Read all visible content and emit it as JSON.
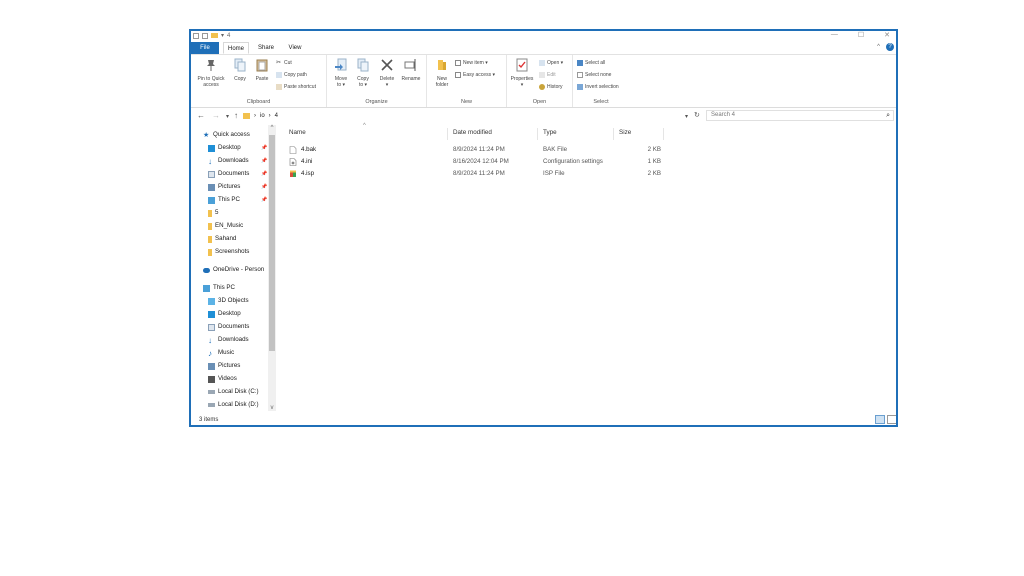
{
  "titlebar": {
    "title": "4"
  },
  "tabs": {
    "file": "File",
    "home": "Home",
    "share": "Share",
    "view": "View"
  },
  "ribbon": {
    "clipboard": {
      "label": "Clipboard",
      "pin_line1": "Pin to Quick",
      "pin_line2": "access",
      "copy": "Copy",
      "paste": "Paste",
      "cut": "Cut",
      "copy_path": "Copy path",
      "paste_shortcut": "Paste shortcut"
    },
    "organize": {
      "label": "Organize",
      "move_line1": "Move",
      "move_line2": "to ▾",
      "copy_line1": "Copy",
      "copy_line2": "to ▾",
      "delete_line1": "Delete",
      "delete_line2": "▾",
      "rename": "Rename"
    },
    "new": {
      "label": "New",
      "folder_line1": "New",
      "folder_line2": "folder",
      "new_item": "New item ▾",
      "easy_access": "Easy access ▾"
    },
    "open": {
      "label": "Open",
      "properties_line1": "Properties",
      "properties_line2": "▾",
      "open": "Open ▾",
      "edit": "Edit",
      "history": "History"
    },
    "select": {
      "label": "Select",
      "select_all": "Select all",
      "select_none": "Select none",
      "invert": "Invert selection"
    }
  },
  "address": {
    "crumb1": "io",
    "crumb2": "4",
    "search_placeholder": "Search 4"
  },
  "nav": {
    "quick_access": "Quick access",
    "qa_items": [
      "Desktop",
      "Downloads",
      "Documents",
      "Pictures",
      "This PC",
      "5",
      "EN_Music",
      "Sahand",
      "Screenshots"
    ],
    "onedrive": "OneDrive - Person",
    "this_pc": "This PC",
    "pc_items": [
      "3D Objects",
      "Desktop",
      "Documents",
      "Downloads",
      "Music",
      "Pictures",
      "Videos",
      "Local Disk (C:)",
      "Local Disk (D:)"
    ]
  },
  "columns": {
    "name": "Name",
    "date": "Date modified",
    "type": "Type",
    "size": "Size"
  },
  "files": [
    {
      "name": "4.bak",
      "date": "8/9/2024 11:24 PM",
      "type": "BAK File",
      "size": "2 KB",
      "icon": "blank-file-icon"
    },
    {
      "name": "4.ini",
      "date": "8/16/2024 12:04 PM",
      "type": "Configuration settings",
      "size": "1 KB",
      "icon": "settings-file-icon"
    },
    {
      "name": "4.isp",
      "date": "8/9/2024 11:24 PM",
      "type": "ISP File",
      "size": "2 KB",
      "icon": "package-icon"
    }
  ],
  "status": {
    "count": "3 items"
  },
  "colors": {
    "accent": "#1f6fb8",
    "folder": "#f2c14e"
  }
}
